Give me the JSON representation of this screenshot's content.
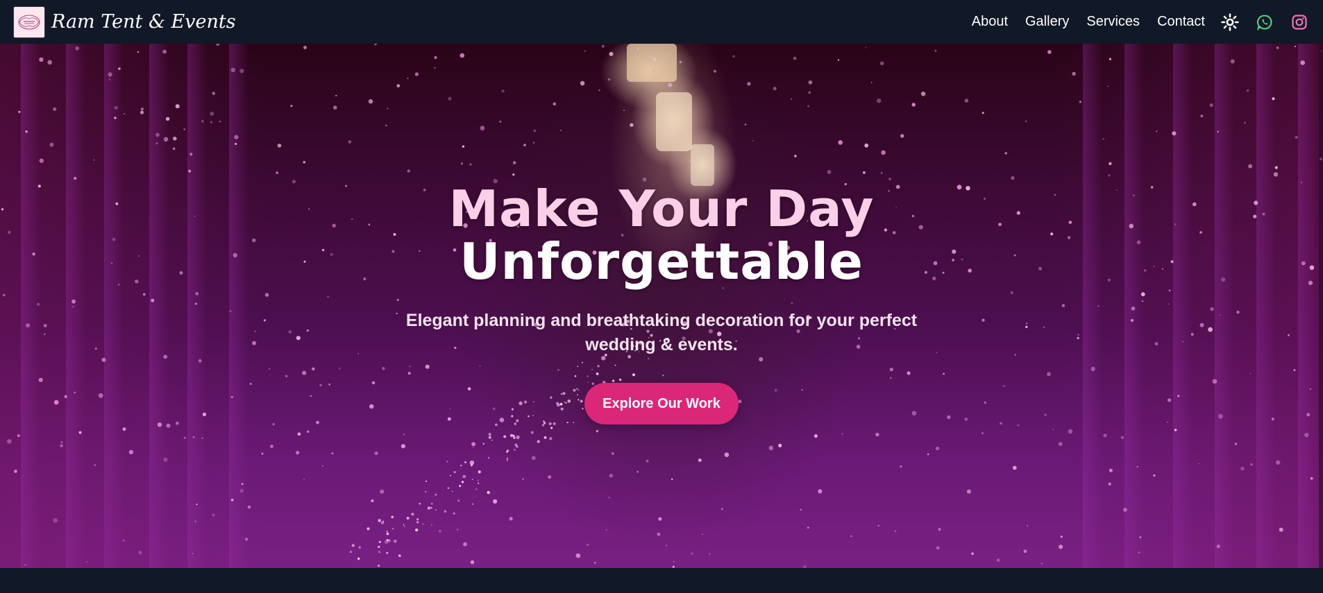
{
  "brand": {
    "name": "Ram Tent & Events",
    "logo_icon": "ornamental-logo"
  },
  "nav": {
    "links": [
      "About",
      "Gallery",
      "Services",
      "Contact"
    ],
    "icons": {
      "theme": "sun-icon",
      "whatsapp": "whatsapp-icon",
      "instagram": "instagram-icon"
    },
    "colors": {
      "whatsapp": "#4ade80",
      "instagram": "#f472b6",
      "theme": "#ffffff"
    }
  },
  "hero": {
    "title_line1": "Make Your Day",
    "title_line2": "Unforgettable",
    "subtitle": "Elegant planning and breathtaking decoration for your perfect wedding & events.",
    "cta_label": "Explore Our Work"
  },
  "colors": {
    "navbar_bg": "#111827",
    "accent": "#db2777",
    "title_pink": "#fbcfe8"
  }
}
